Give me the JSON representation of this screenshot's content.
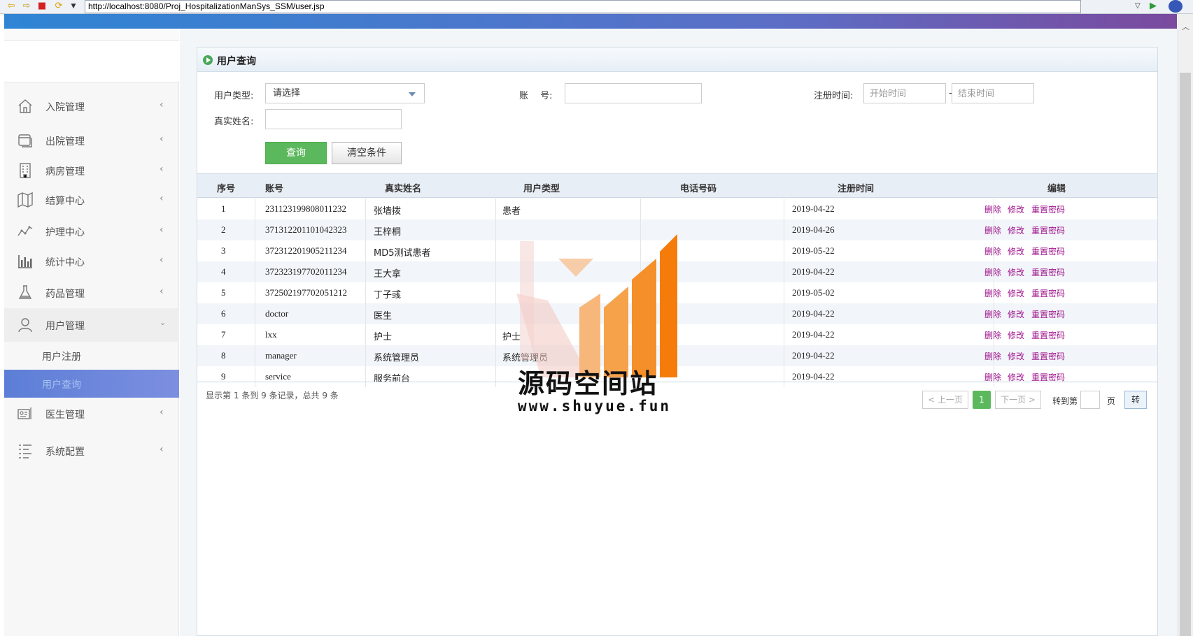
{
  "browser": {
    "url": "http://localhost:8080/Proj_HospitalizationManSys_SSM/user.jsp"
  },
  "sidebar": {
    "items": [
      {
        "label": "入院管理",
        "icon": "home-icon"
      },
      {
        "label": "出院管理",
        "icon": "window-icon"
      },
      {
        "label": "病房管理",
        "icon": "building-icon"
      },
      {
        "label": "结算中心",
        "icon": "map-icon"
      },
      {
        "label": "护理中心",
        "icon": "pulse-icon"
      },
      {
        "label": "统计中心",
        "icon": "bar-chart-icon"
      },
      {
        "label": "药品管理",
        "icon": "flask-icon"
      },
      {
        "label": "用户管理",
        "icon": "user-icon"
      },
      {
        "label": "医生管理",
        "icon": "id-card-icon"
      },
      {
        "label": "系统配置",
        "icon": "list-icon"
      }
    ],
    "sub_items": [
      "用户注册",
      "用户查询"
    ]
  },
  "panel": {
    "title": "用户查询"
  },
  "filters": {
    "user_type_label": "用户类型:",
    "user_type_value": "请选择",
    "account_label": "账　 号:",
    "reg_time_label": "注册时间:",
    "start_placeholder": "开始时间",
    "end_placeholder": "结束时间",
    "range_sep": "-",
    "real_name_label": "真实姓名:",
    "query_button": "查询",
    "clear_button": "清空条件"
  },
  "table": {
    "headers": [
      "序号",
      "账号",
      "真实姓名",
      "用户类型",
      "电话号码",
      "注册时间",
      "编辑"
    ],
    "rows": [
      {
        "no": "1",
        "account": "231123199808011232",
        "name": "张墙拨",
        "type": "患者",
        "phone": "",
        "date": "2019-04-22"
      },
      {
        "no": "2",
        "account": "371312201101042323",
        "name": "王梓桐",
        "type": "",
        "phone": "",
        "date": "2019-04-26"
      },
      {
        "no": "3",
        "account": "372312201905211234",
        "name": "MD5测试患者",
        "type": "",
        "phone": "",
        "date": "2019-05-22"
      },
      {
        "no": "4",
        "account": "372323197702011234",
        "name": "王大拿",
        "type": "",
        "phone": "",
        "date": "2019-04-22"
      },
      {
        "no": "5",
        "account": "372502197702051212",
        "name": "丁子彧",
        "type": "",
        "phone": "",
        "date": "2019-05-02"
      },
      {
        "no": "6",
        "account": "doctor",
        "name": "医生",
        "type": "",
        "phone": "",
        "date": "2019-04-22"
      },
      {
        "no": "7",
        "account": "lxx",
        "name": "护士",
        "type": "护士",
        "phone": "",
        "date": "2019-04-22"
      },
      {
        "no": "8",
        "account": "manager",
        "name": "系统管理员",
        "type": "系统管理员",
        "phone": "",
        "date": "2019-04-22"
      },
      {
        "no": "9",
        "account": "service",
        "name": "服务前台",
        "type": "",
        "phone": "",
        "date": "2019-04-22"
      }
    ],
    "ops": {
      "delete": "删除",
      "edit": "修改",
      "reset": "重置密码"
    }
  },
  "pagination": {
    "summary": "显示第 1 条到 9 条记录，总共 9 条",
    "prev": "< 上一页",
    "current": "1",
    "next": "下一页 >",
    "goto_label": "转到第",
    "page_label": "页",
    "go_button": "转"
  },
  "watermark": {
    "title": "源码空间站",
    "url": "www.shuyue.fun"
  },
  "colors": {
    "accent_green": "#5cb85c",
    "link_purple": "#a0148c",
    "active_menu": "#6f88dd"
  }
}
